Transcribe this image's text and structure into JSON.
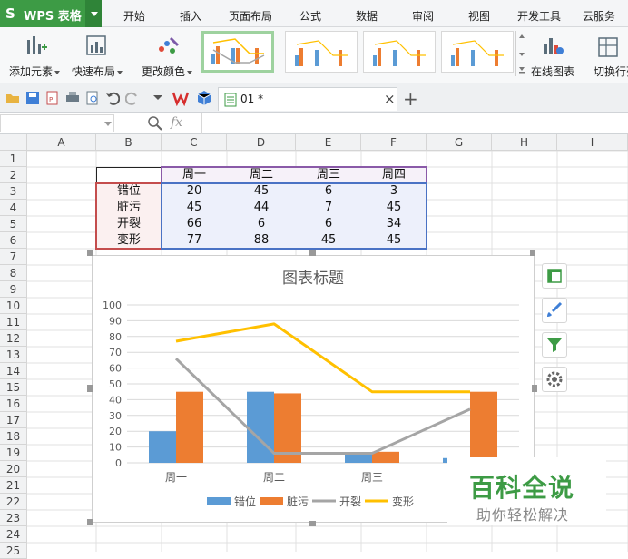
{
  "app": {
    "name": "WPS 表格",
    "logo_glyph": "S"
  },
  "menu_tabs": [
    "开始",
    "插入",
    "页面布局",
    "公式",
    "数据",
    "审阅",
    "视图",
    "开发工具",
    "云服务"
  ],
  "ribbon": {
    "add_element": "添加元素",
    "quick_layout": "快速布局",
    "change_color": "更改颜色",
    "online_chart": "在线图表",
    "switch_rowcol": "切换行列"
  },
  "doc_tab": {
    "name": "01 *",
    "close": "×",
    "new_tab": "+"
  },
  "formula_bar": {
    "fx": "fx"
  },
  "columns": [
    "A",
    "B",
    "C",
    "D",
    "E",
    "F",
    "G",
    "H",
    "I"
  ],
  "rows": [
    "1",
    "2",
    "3",
    "4",
    "5",
    "6",
    "7",
    "8",
    "9",
    "10",
    "11",
    "12",
    "13",
    "14",
    "15",
    "16",
    "17",
    "18",
    "19",
    "20",
    "21",
    "22",
    "23",
    "24",
    "25"
  ],
  "table": {
    "headers": [
      "周一",
      "周二",
      "周三",
      "周四"
    ],
    "rows": [
      {
        "label": "错位",
        "values": [
          "20",
          "45",
          "6",
          "3"
        ]
      },
      {
        "label": "脏污",
        "values": [
          "45",
          "44",
          "7",
          "45"
        ]
      },
      {
        "label": "开裂",
        "values": [
          "66",
          "6",
          "6",
          "34"
        ]
      },
      {
        "label": "变形",
        "values": [
          "77",
          "88",
          "45",
          "45"
        ]
      }
    ]
  },
  "chart_data": {
    "type": "bar",
    "title": "图表标题",
    "categories": [
      "周一",
      "周二",
      "周三",
      "周四"
    ],
    "ylim": [
      0,
      100
    ],
    "yticks": [
      0,
      10,
      20,
      30,
      40,
      50,
      60,
      70,
      80,
      90,
      100
    ],
    "legend_position": "bottom",
    "grid": true,
    "series": [
      {
        "name": "错位",
        "kind": "bar",
        "color": "#5b9bd5",
        "values": [
          20,
          45,
          6,
          3
        ]
      },
      {
        "name": "脏污",
        "kind": "bar",
        "color": "#ed7d31",
        "values": [
          45,
          44,
          7,
          45
        ]
      },
      {
        "name": "开裂",
        "kind": "line",
        "color": "#a5a5a5",
        "values": [
          66,
          6,
          6,
          34
        ]
      },
      {
        "name": "变形",
        "kind": "line",
        "color": "#ffc000",
        "values": [
          77,
          88,
          45,
          45
        ]
      }
    ]
  },
  "watermark": {
    "title": "百科全说",
    "subtitle": "助你轻松解决"
  },
  "colors": {
    "accent": "#3d9b45",
    "header_border": "#8a5aa8",
    "label_border": "#c44d4d",
    "value_border": "#4a72c4"
  }
}
